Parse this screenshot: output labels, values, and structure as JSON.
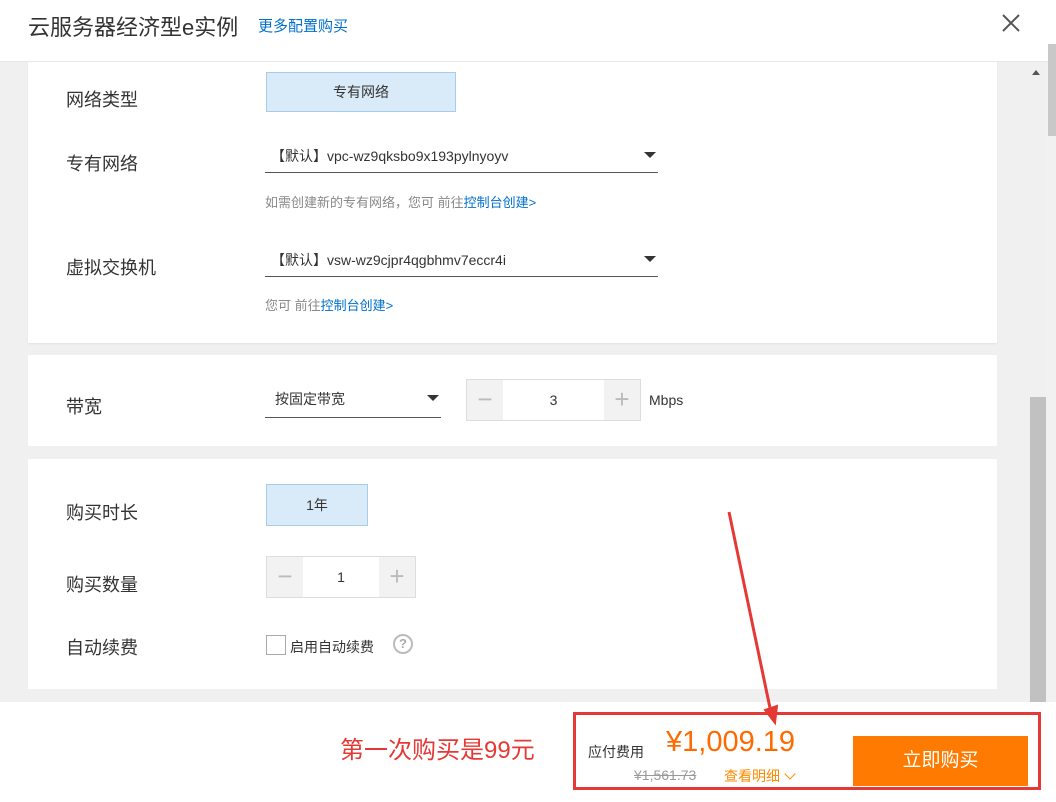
{
  "header": {
    "title": "云服务器经济型e实例",
    "more_link": "更多配置购买"
  },
  "network": {
    "type_label": "网络类型",
    "type_value": "专有网络",
    "vpc_label": "专有网络",
    "vpc_value": "【默认】vpc-wz9qksbo9x193pylnyoyv",
    "vpc_hint_prefix": "如需创建新的专有网络，您可 前往",
    "vpc_hint_link": "控制台创建>",
    "vswitch_label": "虚拟交换机",
    "vswitch_value": "【默认】vsw-wz9cjpr4qgbhmv7eccr4i",
    "vswitch_hint_prefix": "您可 前往",
    "vswitch_hint_link": "控制台创建>"
  },
  "bandwidth": {
    "label": "带宽",
    "mode_value": "按固定带宽",
    "value": "3",
    "unit": "Mbps"
  },
  "purchase": {
    "duration_label": "购买时长",
    "duration_value": "1年",
    "quantity_label": "购买数量",
    "quantity_value": "1",
    "autorenew_label": "自动续费",
    "autorenew_checkbox_label": "启用自动续费",
    "help_glyph": "?"
  },
  "footer": {
    "annotation": "第一次购买是99元",
    "fee_label": "应付费用",
    "price": "¥1,009.19",
    "original_price": "¥1,561.73",
    "detail_link": "查看明细",
    "buy_button": "立即购买"
  },
  "stepper_glyphs": {
    "minus": "−",
    "plus": "+"
  },
  "colors": {
    "accent_orange": "#ff7a00",
    "price_orange": "#ff6a00",
    "link_blue": "#0070cc",
    "annotation_red": "#e53935",
    "selected_bg": "#d9ebf8"
  }
}
